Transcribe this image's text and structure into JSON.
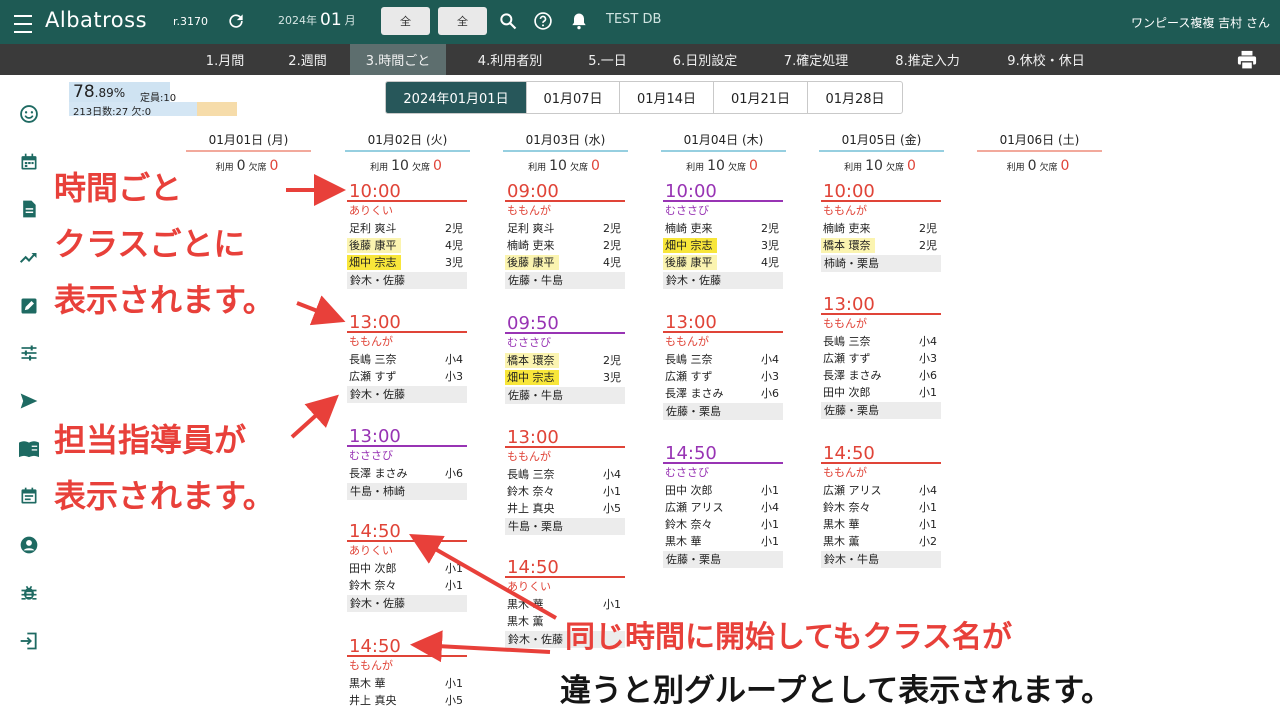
{
  "app": {
    "title": "Albatross",
    "version": "r.3170"
  },
  "header": {
    "period_year": "2024年",
    "period_month": "01",
    "period_suffix": "月",
    "btn_all_1": "全",
    "btn_all_2": "全",
    "db_label": "TEST DB",
    "user_label": "ワンピース複複 吉村 さん",
    "icons": [
      "menu-icon",
      "refresh-icon",
      "search-icon",
      "help-icon",
      "bell-icon",
      "print-icon"
    ]
  },
  "nav": [
    "1.月間",
    "2.週間",
    "3.時間ごと",
    "4.利用者別",
    "5.一日",
    "6.日別設定",
    "7.確定処理",
    "8.推定入力",
    "9.休校・休日"
  ],
  "nav_active": "3.時間ごと",
  "sidebar_icons": [
    "smile-icon",
    "calendar-icon",
    "document-icon",
    "trend-icon",
    "edit-icon",
    "tune-icon",
    "send-icon",
    "book-icon",
    "calendar-note-icon",
    "account-icon",
    "bug-icon",
    "login-icon"
  ],
  "stats": {
    "pct_main": "78",
    "pct_dec": ".89%",
    "capacity": "定員:10",
    "days": "213日数:27 欠:0"
  },
  "date_tabs": [
    "2024年01月01日",
    "01月07日",
    "01月14日",
    "01月21日",
    "01月28日"
  ],
  "date_tab_active": "2024年01月01日",
  "usage_labels": {
    "use": "利用",
    "absent": "欠席"
  },
  "days": [
    {
      "label": "01月01日 (月)",
      "use": "0",
      "absent": "0"
    },
    {
      "label": "01月02日 (火)",
      "use": "10",
      "absent": "0"
    },
    {
      "label": "01月03日 (水)",
      "use": "10",
      "absent": "0"
    },
    {
      "label": "01月04日 (木)",
      "use": "10",
      "absent": "0"
    },
    {
      "label": "01月05日 (金)",
      "use": "10",
      "absent": "0"
    },
    {
      "label": "01月06日 (土)",
      "use": "0",
      "absent": "0"
    }
  ],
  "columns": [
    [],
    [
      {
        "time": "10:00",
        "cls": "ありくい",
        "rows": [
          [
            "足利 爽斗",
            "2児",
            ""
          ],
          [
            "後藤 康平",
            "4児",
            "y"
          ],
          [
            "畑中 宗志",
            "3児",
            "Y"
          ]
        ],
        "staff": "鈴木・佐藤"
      },
      {
        "time": "13:00",
        "cls": "ももんが",
        "rows": [
          [
            "長嶋 三奈",
            "小4",
            ""
          ],
          [
            "広瀬 すず",
            "小3",
            ""
          ]
        ],
        "staff": "鈴木・佐藤"
      },
      {
        "time": "13:00",
        "cls": "むささび",
        "rows": [
          [
            "長澤 まさみ",
            "小6",
            ""
          ]
        ],
        "staff": "牛島・柿崎"
      },
      {
        "time": "14:50",
        "cls": "ありくい",
        "rows": [
          [
            "田中 次郎",
            "小1",
            ""
          ],
          [
            "鈴木 奈々",
            "小1",
            ""
          ]
        ],
        "staff": "鈴木・佐藤"
      },
      {
        "time": "14:50",
        "cls": "ももんが",
        "rows": [
          [
            "黒木 華",
            "小1",
            ""
          ],
          [
            "井上 真央",
            "小5",
            ""
          ]
        ],
        "staff": ""
      }
    ],
    [
      {
        "time": "09:00",
        "cls": "ももんが",
        "rows": [
          [
            "足利 爽斗",
            "2児",
            ""
          ],
          [
            "楠崎 吏来",
            "2児",
            ""
          ],
          [
            "後藤 康平",
            "4児",
            "y"
          ]
        ],
        "staff": "佐藤・牛島"
      },
      {
        "time": "09:50",
        "cls": "むささび",
        "rows": [
          [
            "橋本 環奈",
            "2児",
            "y"
          ],
          [
            "畑中 宗志",
            "3児",
            "Y"
          ]
        ],
        "staff": "佐藤・牛島"
      },
      {
        "time": "13:00",
        "cls": "ももんが",
        "rows": [
          [
            "長嶋 三奈",
            "小4",
            ""
          ],
          [
            "鈴木 奈々",
            "小1",
            ""
          ],
          [
            "井上 真央",
            "小5",
            ""
          ]
        ],
        "staff": "牛島・栗島"
      },
      {
        "time": "14:50",
        "cls": "ありくい",
        "rows": [
          [
            "黒木 華",
            "小1",
            ""
          ],
          [
            "黒木 薫",
            "",
            ""
          ]
        ],
        "staff": "鈴木・佐藤"
      }
    ],
    [
      {
        "time": "10:00",
        "cls": "むささび",
        "rows": [
          [
            "楠崎 吏来",
            "2児",
            ""
          ],
          [
            "畑中 宗志",
            "3児",
            "Y"
          ],
          [
            "後藤 康平",
            "4児",
            "y"
          ]
        ],
        "staff": "鈴木・佐藤"
      },
      {
        "time": "13:00",
        "cls": "ももんが",
        "rows": [
          [
            "長嶋 三奈",
            "小4",
            ""
          ],
          [
            "広瀬 すず",
            "小3",
            ""
          ],
          [
            "長澤 まさみ",
            "小6",
            ""
          ]
        ],
        "staff": "佐藤・栗島"
      },
      {
        "time": "14:50",
        "cls": "むささび",
        "rows": [
          [
            "田中 次郎",
            "小1",
            ""
          ],
          [
            "広瀬 アリス",
            "小4",
            ""
          ],
          [
            "鈴木 奈々",
            "小1",
            ""
          ],
          [
            "黒木 華",
            "小1",
            ""
          ]
        ],
        "staff": "佐藤・栗島"
      }
    ],
    [
      {
        "time": "10:00",
        "cls": "ももんが",
        "rows": [
          [
            "楠崎 吏来",
            "2児",
            ""
          ],
          [
            "橋本 環奈",
            "2児",
            "y"
          ]
        ],
        "staff": "柿崎・栗島"
      },
      {
        "time": "13:00",
        "cls": "ももんが",
        "rows": [
          [
            "長嶋 三奈",
            "小4",
            ""
          ],
          [
            "広瀬 すず",
            "小3",
            ""
          ],
          [
            "長澤 まさみ",
            "小6",
            ""
          ],
          [
            "田中 次郎",
            "小1",
            ""
          ]
        ],
        "staff": "佐藤・栗島"
      },
      {
        "time": "14:50",
        "cls": "ももんが",
        "rows": [
          [
            "広瀬 アリス",
            "小4",
            ""
          ],
          [
            "鈴木 奈々",
            "小1",
            ""
          ],
          [
            "黒木 華",
            "小1",
            ""
          ],
          [
            "黒木 薫",
            "小2",
            ""
          ]
        ],
        "staff": "鈴木・牛島"
      }
    ],
    []
  ],
  "annotations": {
    "a1_l1": "時間ごと",
    "a1_l2": "クラスごとに",
    "a1_l3": "表示されます。",
    "a2_l1": "担当指導員が",
    "a2_l2": "表示されます。",
    "a3_l1": "同じ時間に開始してもクラス名が",
    "a3_l2": "違うと別グループとして表示されます。"
  }
}
